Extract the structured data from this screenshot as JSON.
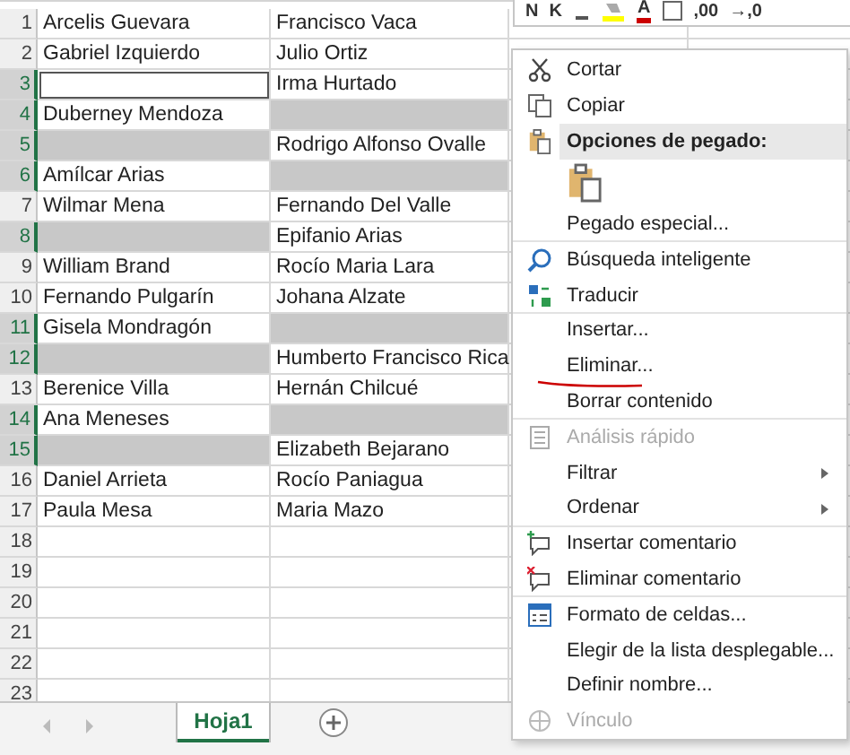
{
  "mini_toolbar": [
    {
      "kind": "text",
      "label": "N"
    },
    {
      "kind": "text",
      "label": "K"
    },
    {
      "kind": "underline"
    },
    {
      "kind": "fill"
    },
    {
      "kind": "fontcolor",
      "label": "A"
    },
    {
      "kind": "border"
    },
    {
      "kind": "text",
      "label": ",00"
    },
    {
      "kind": "text",
      "label": "→,0"
    }
  ],
  "rows": [
    {
      "number": "1",
      "cells": [
        {
          "text": "Arcelis Guevara",
          "selected": false
        },
        {
          "text": "Francisco Vaca",
          "selected": false
        }
      ]
    },
    {
      "number": "2",
      "cells": [
        {
          "text": "Gabriel Izquierdo",
          "selected": false
        },
        {
          "text": "Julio Ortiz",
          "selected": false
        }
      ]
    },
    {
      "number": "3",
      "cells": [
        {
          "text": "",
          "selected": true,
          "active": true
        },
        {
          "text": "Irma Hurtado",
          "selected": false
        }
      ]
    },
    {
      "number": "4",
      "cells": [
        {
          "text": "Duberney Mendoza",
          "selected": false
        },
        {
          "text": "",
          "selected": true
        }
      ]
    },
    {
      "number": "5",
      "cells": [
        {
          "text": "",
          "selected": true
        },
        {
          "text": "Rodrigo Alfonso Ovalle",
          "selected": false
        }
      ]
    },
    {
      "number": "6",
      "cells": [
        {
          "text": "Amílcar Arias",
          "selected": false
        },
        {
          "text": "",
          "selected": true
        }
      ]
    },
    {
      "number": "7",
      "cells": [
        {
          "text": "Wilmar Mena",
          "selected": false
        },
        {
          "text": "Fernando Del Valle",
          "selected": false
        }
      ]
    },
    {
      "number": "8",
      "cells": [
        {
          "text": "",
          "selected": true
        },
        {
          "text": "Epifanio Arias",
          "selected": false
        }
      ]
    },
    {
      "number": "9",
      "cells": [
        {
          "text": "William Brand",
          "selected": false
        },
        {
          "text": "Rocío Maria Lara",
          "selected": false
        }
      ]
    },
    {
      "number": "10",
      "cells": [
        {
          "text": "Fernando Pulgarín",
          "selected": false
        },
        {
          "text": "Johana Alzate",
          "selected": false
        }
      ]
    },
    {
      "number": "11",
      "cells": [
        {
          "text": "Gisela Mondragón",
          "selected": false
        },
        {
          "text": "",
          "selected": true
        }
      ]
    },
    {
      "number": "12",
      "cells": [
        {
          "text": "",
          "selected": true
        },
        {
          "text": "Humberto Francisco Rica",
          "selected": false
        }
      ]
    },
    {
      "number": "13",
      "cells": [
        {
          "text": "Berenice Villa",
          "selected": false
        },
        {
          "text": "Hernán Chilcué",
          "selected": false
        }
      ]
    },
    {
      "number": "14",
      "cells": [
        {
          "text": "Ana Meneses",
          "selected": false
        },
        {
          "text": "",
          "selected": true
        }
      ]
    },
    {
      "number": "15",
      "cells": [
        {
          "text": "",
          "selected": true
        },
        {
          "text": "Elizabeth Bejarano",
          "selected": false
        }
      ]
    },
    {
      "number": "16",
      "cells": [
        {
          "text": "Daniel Arrieta",
          "selected": false
        },
        {
          "text": "Rocío Paniagua",
          "selected": false
        }
      ]
    },
    {
      "number": "17",
      "cells": [
        {
          "text": "Paula Mesa",
          "selected": false
        },
        {
          "text": "Maria Mazo",
          "selected": false
        }
      ]
    },
    {
      "number": "18",
      "cells": [
        {
          "text": "",
          "selected": false
        },
        {
          "text": "",
          "selected": false
        }
      ]
    },
    {
      "number": "19",
      "cells": [
        {
          "text": "",
          "selected": false
        },
        {
          "text": "",
          "selected": false
        }
      ]
    },
    {
      "number": "20",
      "cells": [
        {
          "text": "",
          "selected": false
        },
        {
          "text": "",
          "selected": false
        }
      ]
    },
    {
      "number": "21",
      "cells": [
        {
          "text": "",
          "selected": false
        },
        {
          "text": "",
          "selected": false
        }
      ]
    },
    {
      "number": "22",
      "cells": [
        {
          "text": "",
          "selected": false
        },
        {
          "text": "",
          "selected": false
        }
      ]
    },
    {
      "number": "23",
      "cells": [
        {
          "text": "",
          "selected": false
        },
        {
          "text": "",
          "selected": false
        }
      ]
    }
  ],
  "context_menu": [
    {
      "kind": "scissors",
      "label": "Cortar",
      "disabled": false,
      "submenu": false,
      "separator_before": false,
      "marked": false
    },
    {
      "kind": "copy",
      "label": "Copiar",
      "disabled": false,
      "submenu": false,
      "separator_before": false,
      "marked": false
    },
    {
      "kind": "header",
      "label": "Opciones de pegado:"
    },
    {
      "kind": "paste"
    },
    {
      "kind": "plain",
      "label": "Pegado especial...",
      "disabled": false,
      "submenu": false,
      "separator_before": false,
      "marked": false
    },
    {
      "kind": "search",
      "label": "Búsqueda inteligente",
      "disabled": false,
      "submenu": false,
      "separator_before": true,
      "marked": false
    },
    {
      "kind": "translate",
      "label": "Traducir",
      "disabled": false,
      "submenu": false,
      "separator_before": false,
      "marked": false
    },
    {
      "kind": "plain",
      "label": "Insertar...",
      "disabled": false,
      "submenu": false,
      "separator_before": true,
      "marked": false
    },
    {
      "kind": "plain",
      "label": "Eliminar...",
      "disabled": false,
      "submenu": false,
      "separator_before": false,
      "marked": true
    },
    {
      "kind": "plain",
      "label": "Borrar contenido",
      "disabled": false,
      "submenu": false,
      "separator_before": false,
      "marked": false
    },
    {
      "kind": "analysis",
      "label": "Análisis rápido",
      "disabled": true,
      "submenu": false,
      "separator_before": true,
      "marked": false
    },
    {
      "kind": "plain",
      "label": "Filtrar",
      "disabled": false,
      "submenu": true,
      "separator_before": false,
      "marked": false
    },
    {
      "kind": "plain",
      "label": "Ordenar",
      "disabled": false,
      "submenu": true,
      "separator_before": false,
      "marked": false
    },
    {
      "kind": "add-comment",
      "label": "Insertar comentario",
      "disabled": false,
      "submenu": false,
      "separator_before": true,
      "marked": false
    },
    {
      "kind": "delete-comment",
      "label": "Eliminar comentario",
      "disabled": false,
      "submenu": false,
      "separator_before": false,
      "marked": false
    },
    {
      "kind": "format",
      "label": "Formato de celdas...",
      "disabled": false,
      "submenu": false,
      "separator_before": true,
      "marked": false
    },
    {
      "kind": "plain",
      "label": "Elegir de la lista desplegable...",
      "disabled": false,
      "submenu": false,
      "separator_before": false,
      "marked": false
    },
    {
      "kind": "plain",
      "label": "Definir nombre...",
      "disabled": false,
      "submenu": false,
      "separator_before": false,
      "marked": false
    },
    {
      "kind": "link",
      "label": "Vínculo",
      "disabled": true,
      "submenu": false,
      "separator_before": false,
      "marked": false
    }
  ],
  "sheet_tabs": [
    {
      "label": "Hoja1",
      "selected": true
    }
  ]
}
